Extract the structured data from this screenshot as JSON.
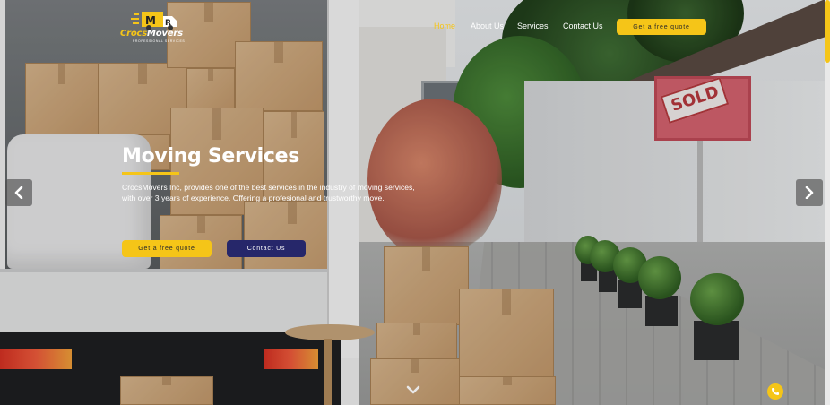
{
  "brand": {
    "name_part1": "Crocs",
    "name_part2": "Movers",
    "tagline": "PROFESSIONAL SERVICES",
    "accent_color": "#f5c518",
    "dark_button_color": "#26276a"
  },
  "nav": {
    "items": [
      {
        "label": "Home",
        "active": true
      },
      {
        "label": "About Us",
        "active": false
      },
      {
        "label": "Services",
        "active": false
      },
      {
        "label": "Contact Us",
        "active": false
      }
    ],
    "cta_label": "Get a free quote"
  },
  "hero": {
    "title": "Moving Services",
    "description": "CrocsMovers Inc, provides one of the best services in the industry of moving services, with over 3 years of experience. Offering a profesional and trustworthy move.",
    "primary_button": "Get a free quote",
    "secondary_button": "Contact Us"
  },
  "scene": {
    "sign_text": "SOLD"
  },
  "icons": {
    "prev": "chevron-left-icon",
    "next": "chevron-right-icon",
    "scroll": "chevron-down-icon",
    "phone": "phone-icon"
  }
}
